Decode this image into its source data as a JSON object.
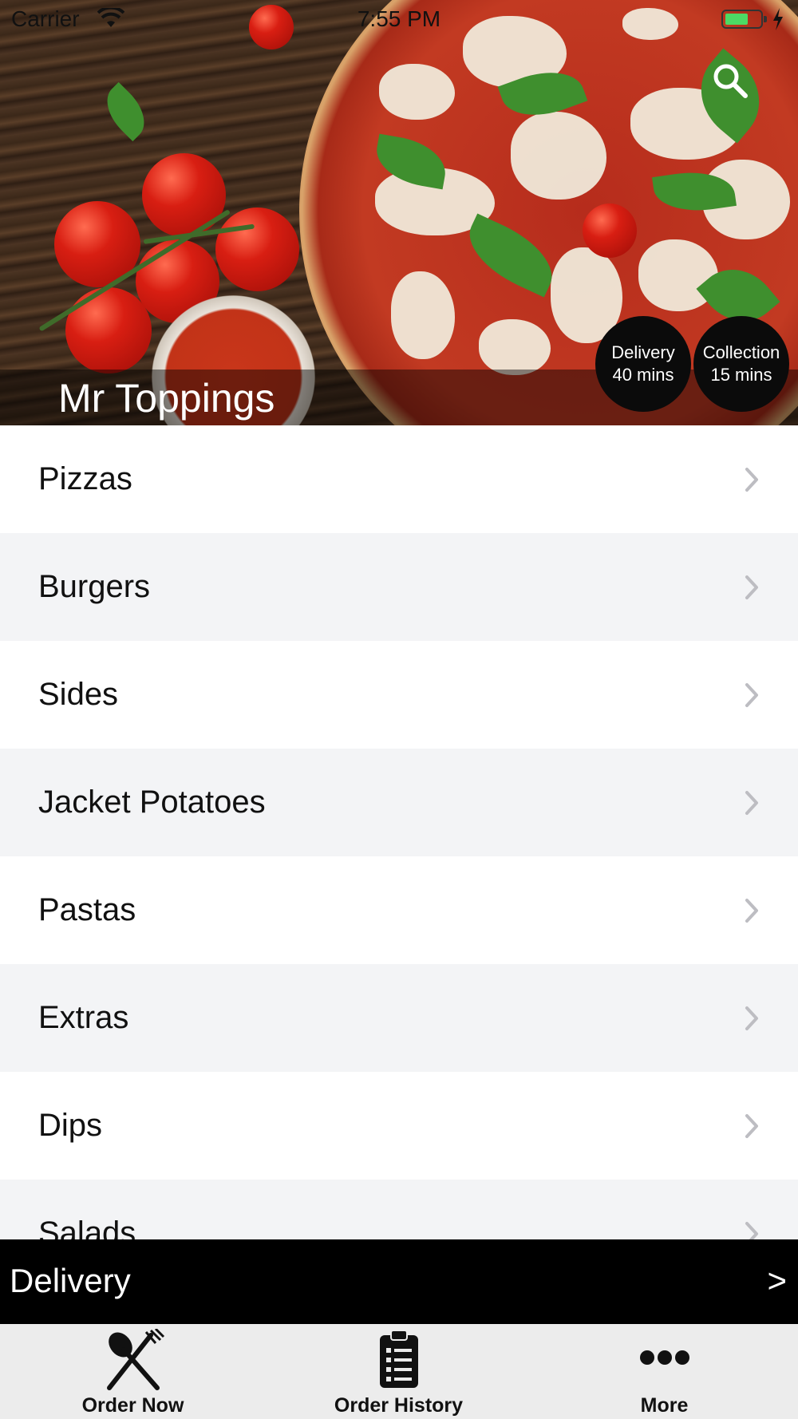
{
  "status_bar": {
    "carrier": "Carrier",
    "time": "7:55 PM"
  },
  "hero": {
    "store_name": "Mr Toppings",
    "delivery_badge": {
      "line1": "Delivery",
      "line2": "40 mins"
    },
    "collection_badge": {
      "line1": "Collection",
      "line2": "15 mins"
    },
    "search_icon": "search-icon"
  },
  "menu": {
    "categories": [
      {
        "label": "Pizzas"
      },
      {
        "label": "Burgers"
      },
      {
        "label": "Sides"
      },
      {
        "label": "Jacket Potatoes"
      },
      {
        "label": "Pastas"
      },
      {
        "label": "Extras"
      },
      {
        "label": "Dips"
      },
      {
        "label": "Salads"
      }
    ]
  },
  "delivery_bar": {
    "label": "Delivery",
    "arrow": ">"
  },
  "tabbar": {
    "tabs": [
      {
        "label": "Order Now",
        "icon": "fork-knife-icon"
      },
      {
        "label": "Order History",
        "icon": "clipboard-list-icon"
      },
      {
        "label": "More",
        "icon": "more-dots-icon"
      }
    ]
  },
  "colors": {
    "battery": "#4cd964",
    "badge_bg": "#0b0b0b",
    "delivery_bar_bg": "#000000",
    "tabbar_bg": "#ececec",
    "row_alt_bg": "#f3f4f6"
  }
}
